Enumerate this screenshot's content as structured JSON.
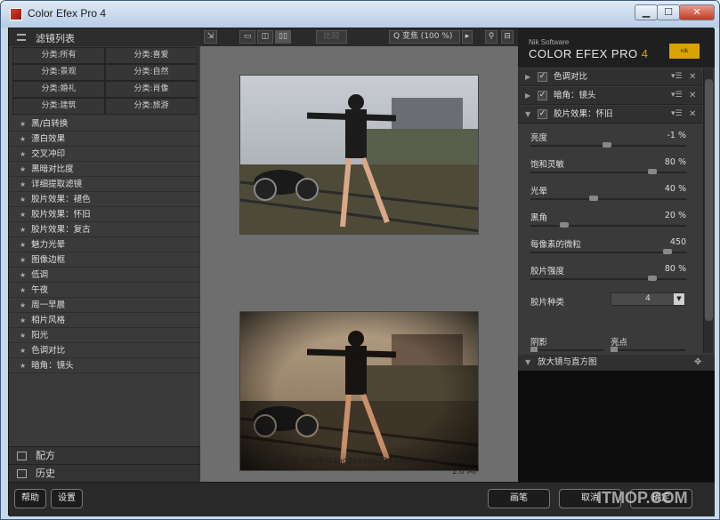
{
  "window": {
    "title": "Color Efex Pro 4",
    "controls": {
      "minimize": "▁",
      "maximize": "☐",
      "close": "✕"
    }
  },
  "left_panel": {
    "header": "滤镜列表",
    "categories": [
      "分类:所有",
      "分类:喜爱",
      "分类:景观",
      "分类:自然",
      "分类:婚礼",
      "分类:肖像",
      "分类:建筑",
      "分类:旅游"
    ],
    "filters": [
      "黑/白转换",
      "漂白效果",
      "交叉冲印",
      "黑暗对比度",
      "详细提取滤镜",
      "胶片效果：褪色",
      "胶片效果：怀旧",
      "胶片效果：复古",
      "魅力光晕",
      "图像边框",
      "低调",
      "午夜",
      "周一早晨",
      "相片风格",
      "阳光",
      "色调对比",
      "暗角：镜头"
    ],
    "bottom": {
      "recipes": "配方",
      "history": "历史"
    }
  },
  "toolbar": {
    "disabled_label": "比较",
    "zoom_label": "Q 变焦 (100 %)"
  },
  "preview": {
    "filename": "20100623_39afbf1aad266ae67214MlpeXegH4XWM.jpg",
    "filesize": "1.0 MP"
  },
  "right_panel": {
    "brand_small": "Nik Software",
    "brand_main": "COLOR EFEX PRO",
    "brand_version": "4",
    "brand_logo": "nik Software",
    "panels": [
      {
        "name": "色调对比",
        "expanded": false
      },
      {
        "name": "暗角：镜头",
        "expanded": false
      },
      {
        "name": "胶片效果：怀旧",
        "expanded": true
      }
    ],
    "sliders": [
      {
        "label": "亮度",
        "value": "-1 %",
        "level": 0.49
      },
      {
        "label": "饱和灵敏",
        "value": "80 %",
        "level": 0.8
      },
      {
        "label": "光晕",
        "value": "40 %",
        "level": 0.4
      },
      {
        "label": "黑角",
        "value": "20 %",
        "level": 0.2
      },
      {
        "label": "每像素的微粒",
        "value": "450",
        "level": 0.9
      },
      {
        "label": "胶片强度",
        "value": "80 %",
        "level": 0.8
      }
    ],
    "film_type": {
      "label": "胶片种类",
      "value": "4"
    },
    "shadows_label": "阴影",
    "highlights_label": "亮点",
    "loupe_label": "放大镜与直方图"
  },
  "footer": {
    "help": "帮助",
    "settings": "设置",
    "brush": "画笔",
    "cancel": "取消",
    "ok": "确定"
  },
  "watermark": "ITMOP.COM"
}
